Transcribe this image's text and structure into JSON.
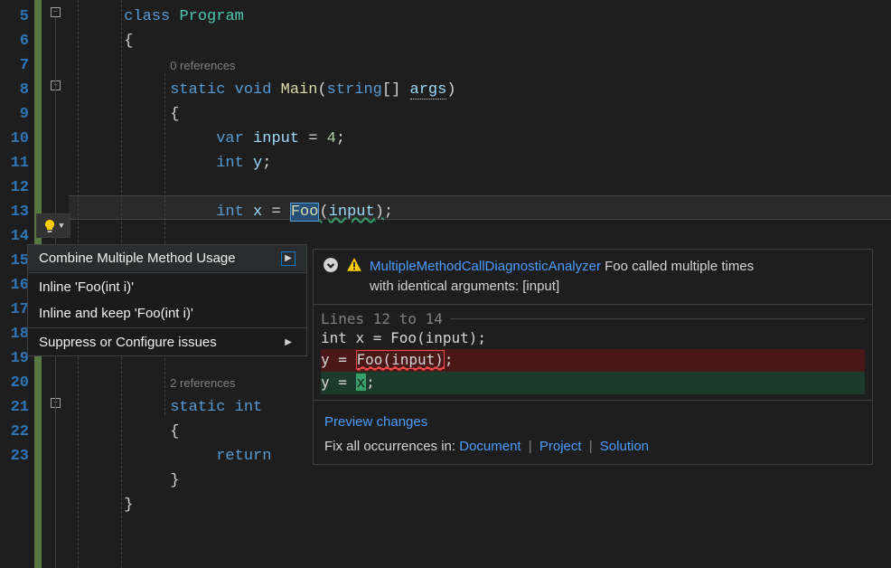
{
  "gutter": {
    "start": 5,
    "lines": [
      "5",
      "6",
      "",
      "7",
      "8",
      "9",
      "10",
      "11",
      "12",
      "13",
      "14",
      "15",
      "16",
      "17",
      "18",
      "",
      "19",
      "20",
      "21",
      "22",
      "23",
      ""
    ]
  },
  "code": {
    "class_kw": "class",
    "class_name": "Program",
    "open_brace": "{",
    "refs0": "0 references",
    "static_kw": "static",
    "void_kw": "void",
    "main": "Main",
    "string_kw": "string",
    "args": "args",
    "var_kw": "var",
    "input": "input",
    "eq4": " = ",
    "four": "4",
    "int_kw": "int",
    "y": "y",
    "x": "x",
    "foo": "Foo",
    "input_arg": "input",
    "refs2": "2 references",
    "return_kw": "return",
    "close_brace": "}"
  },
  "lightbulb": {},
  "menu": {
    "item1": "Combine Multiple Method Usage",
    "item2": "Inline 'Foo(int i)'",
    "item3": "Inline and keep 'Foo(int i)'",
    "item4": "Suppress or Configure issues"
  },
  "diag": {
    "analyzer": "MultipleMethodCallDiagnosticAnalyzer",
    "msg1": "Foo called multiple times",
    "msg2": "with identical arguments: [input]",
    "diff_title": "Lines 12 to 14",
    "l1": "int x = Foo(input);",
    "l2a": "y = ",
    "l2b": "Foo(input)",
    "l2c": ";",
    "l3a": "y = ",
    "l3b": "x",
    "l3c": ";",
    "preview": "Preview changes",
    "fix_label": "Fix all occurrences in:",
    "doc": "Document",
    "proj": "Project",
    "sol": "Solution"
  }
}
